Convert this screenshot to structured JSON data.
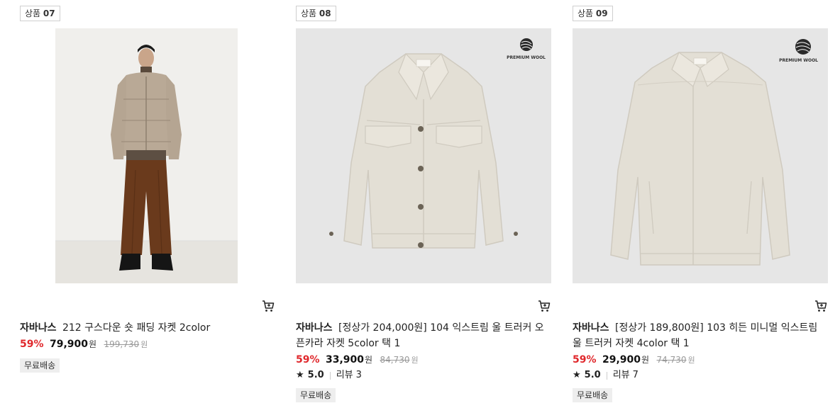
{
  "products": [
    {
      "badge_prefix": "상품",
      "badge_number": "07",
      "brand": "자바나스",
      "title": "212 구스다운 숏 패딩 자켓 2color",
      "discount": "59%",
      "price": "79,900",
      "currency": "원",
      "original_price": "199,730",
      "original_currency": "원",
      "shipping": "무료배송"
    },
    {
      "badge_prefix": "상품",
      "badge_number": "08",
      "brand": "자바나스",
      "title": "[정상가 204,000원] 104 익스트림 울 트러커 오픈카라 자켓 5color 택 1",
      "discount": "59%",
      "price": "33,900",
      "currency": "원",
      "original_price": "84,730",
      "original_currency": "원",
      "rating": "5.0",
      "review_label": "리뷰",
      "review_count": "3",
      "shipping": "무료배송",
      "wool_badge": "PREMIUM WOOL"
    },
    {
      "badge_prefix": "상품",
      "badge_number": "09",
      "brand": "자바나스",
      "title": "[정상가 189,800원] 103 히든 미니멀 익스트림 울 트러커 자켓 4color 택 1",
      "discount": "59%",
      "price": "29,900",
      "currency": "원",
      "original_price": "74,730",
      "original_currency": "원",
      "rating": "5.0",
      "review_label": "리뷰",
      "review_count": "7",
      "shipping": "무료배송",
      "wool_badge": "PREMIUM WOOL"
    }
  ],
  "icons": {
    "cart": "cart-icon",
    "star": "star-icon",
    "wool": "wool-ball-icon"
  },
  "colors": {
    "discount": "#e0282c",
    "jacket": "#e3dfd5",
    "photo_bg": "#e6e6e6"
  }
}
